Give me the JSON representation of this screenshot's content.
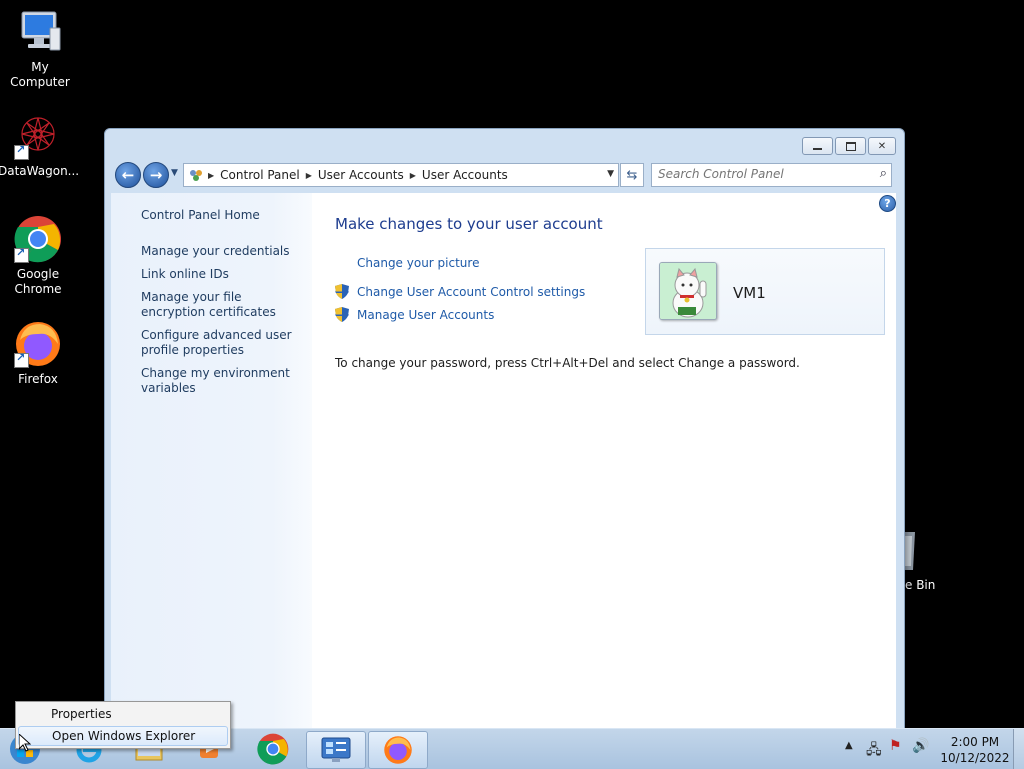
{
  "desktop": {
    "icons": [
      {
        "label": "My Computer",
        "icon": "computer-icon"
      },
      {
        "label": "DataWagon...",
        "icon": "datawagon-icon"
      },
      {
        "label": "Google Chrome",
        "icon": "chrome-icon"
      },
      {
        "label": "Firefox",
        "icon": "firefox-icon"
      }
    ],
    "recycle_bin_label": "e Bin"
  },
  "window": {
    "controls": {
      "minimize": "▭",
      "maximize": "▢",
      "close": "✕"
    },
    "address": {
      "crumbs": [
        "Control Panel",
        "User Accounts",
        "User Accounts"
      ]
    },
    "search": {
      "placeholder": "Search Control Panel"
    },
    "left_pane": {
      "home": "Control Panel Home",
      "links": [
        "Manage your credentials",
        "Link online IDs",
        "Manage your file encryption certificates",
        "Configure advanced user profile properties",
        "Change my environment variables"
      ]
    },
    "main": {
      "title": "Make changes to your user account",
      "tasks": [
        "Change your picture",
        "Change User Account Control settings",
        "Manage User Accounts"
      ],
      "info": "To change your password, press Ctrl+Alt+Del and select Change a password.",
      "user": {
        "name": "VM1"
      }
    }
  },
  "context_menu": {
    "items": [
      "Properties",
      "Open Windows Explorer"
    ]
  },
  "taskbar": {
    "time": "2:00 PM",
    "date": "10/12/2022"
  },
  "colors": {
    "link": "#1e5aa8",
    "title": "#1e3d8f",
    "left_pane": "#e9f1fb",
    "taskbar": "#b6cce4"
  }
}
